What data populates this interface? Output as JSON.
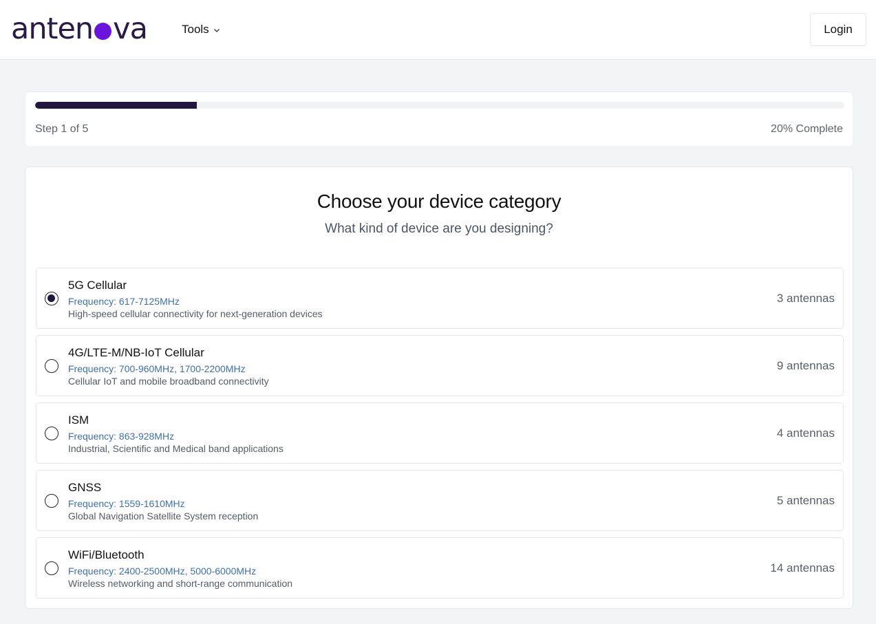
{
  "header": {
    "logo": {
      "before": "anten",
      "after": "va",
      "dot_color": "#6a14e0",
      "text_color": "#2a1a4a"
    },
    "tools_label": "Tools",
    "login_label": "Login"
  },
  "progress": {
    "fraction": 0.2,
    "step_text": "Step 1 of 5",
    "percent_text": "20% Complete"
  },
  "main": {
    "title": "Choose your device category",
    "subtitle": "What kind of device are you designing?",
    "options": [
      {
        "name": "5G Cellular",
        "frequency": "Frequency: 617-7125MHz",
        "description": "High-speed cellular connectivity for next-generation devices",
        "count": "3 antennas",
        "selected": true
      },
      {
        "name": "4G/LTE-M/NB-IoT Cellular",
        "frequency": "Frequency: 700-960MHz, 1700-2200MHz",
        "description": "Cellular IoT and mobile broadband connectivity",
        "count": "9 antennas",
        "selected": false
      },
      {
        "name": "ISM",
        "frequency": "Frequency: 863-928MHz",
        "description": "Industrial, Scientific and Medical band applications",
        "count": "4 antennas",
        "selected": false
      },
      {
        "name": "GNSS",
        "frequency": "Frequency: 1559-1610MHz",
        "description": "Global Navigation Satellite System reception",
        "count": "5 antennas",
        "selected": false
      },
      {
        "name": "WiFi/Bluetooth",
        "frequency": "Frequency: 2400-2500MHz, 5000-6000MHz",
        "description": "Wireless networking and short-range communication",
        "count": "14 antennas",
        "selected": false
      }
    ]
  },
  "colors": {
    "progress_fill": "#22183f",
    "frequency_text": "#3b6fb6"
  }
}
